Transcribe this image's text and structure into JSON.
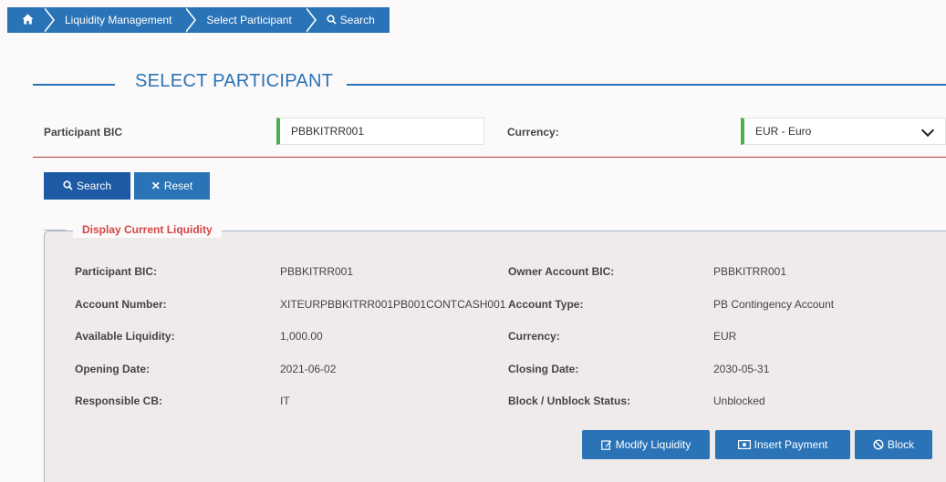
{
  "breadcrumb": {
    "home_icon": "home-icon",
    "items": [
      "Liquidity Management",
      "Select Participant",
      "Search"
    ],
    "search_icon": "search-icon"
  },
  "section_title": "SELECT PARTICIPANT",
  "form": {
    "participant_bic_label": "Participant BIC",
    "participant_bic_value": "PBBKITRR001",
    "currency_label": "Currency:",
    "currency_value": "EUR - Euro"
  },
  "buttons": {
    "search": "Search",
    "reset": "Reset"
  },
  "panel": {
    "title": "Display Current Liquidity",
    "rows": [
      {
        "label": "Participant BIC:",
        "value": "PBBKITRR001",
        "label2": "Owner Account BIC:",
        "value2": "PBBKITRR001"
      },
      {
        "label": "Account Number:",
        "value": "XITEURPBBKITRR001PB001CONTCASH001",
        "label2": "Account Type:",
        "value2": "PB Contingency Account"
      },
      {
        "label": "Available Liquidity:",
        "value": "1,000.00",
        "label2": "Currency:",
        "value2": "EUR"
      },
      {
        "label": "Opening Date:",
        "value": "2021-06-02",
        "label2": "Closing Date:",
        "value2": "2030-05-31"
      },
      {
        "label": "Responsible CB:",
        "value": "IT",
        "label2": "Block / Unblock Status:",
        "value2": "Unblocked"
      }
    ],
    "actions": {
      "modify_liquidity": "Modify Liquidity",
      "insert_payment": "Insert Payment",
      "block": "Block"
    }
  },
  "colors": {
    "primary": "#2a73b7",
    "valid_indicator": "#4caf50",
    "legend_red": "#d64545",
    "divider_red": "#b33a3a"
  }
}
